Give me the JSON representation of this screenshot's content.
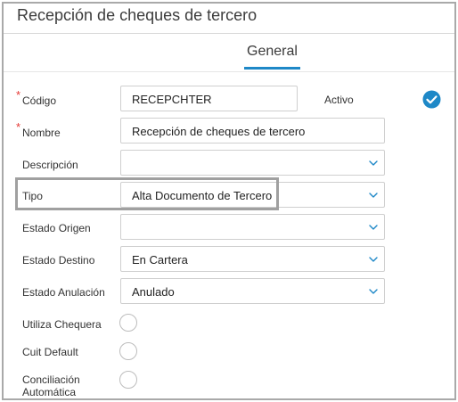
{
  "window": {
    "title": "Recepción de cheques de tercero"
  },
  "tabs": [
    {
      "label": "General",
      "active": true
    }
  ],
  "form": {
    "codigo": {
      "label": "Código",
      "required": true,
      "value": "RECEPCHTER"
    },
    "activo": {
      "label": "Activo",
      "checked": true
    },
    "nombre": {
      "label": "Nombre",
      "required": true,
      "value": "Recepción de cheques de tercero"
    },
    "descripcion": {
      "label": "Descripción",
      "value": ""
    },
    "tipo": {
      "label": "Tipo",
      "value": "Alta Documento de Tercero"
    },
    "estado_origen": {
      "label": "Estado Origen",
      "value": ""
    },
    "estado_destino": {
      "label": "Estado Destino",
      "value": "En Cartera"
    },
    "estado_anulacion": {
      "label": "Estado Anulación",
      "value": "Anulado"
    },
    "utiliza_chequera": {
      "label": "Utiliza Chequera",
      "checked": false
    },
    "cuit_default": {
      "label": "Cuit Default",
      "checked": false
    },
    "conciliacion_automatica": {
      "label_line1": "Conciliación",
      "label_line2": "Automática",
      "checked": false
    }
  },
  "colors": {
    "accent": "#1e88c7",
    "required_asterisk": "#e53935",
    "check_fill": "#1e88c7"
  },
  "icons": {
    "dropdown": "chevron-down-icon",
    "activo": "check-circle-icon"
  }
}
